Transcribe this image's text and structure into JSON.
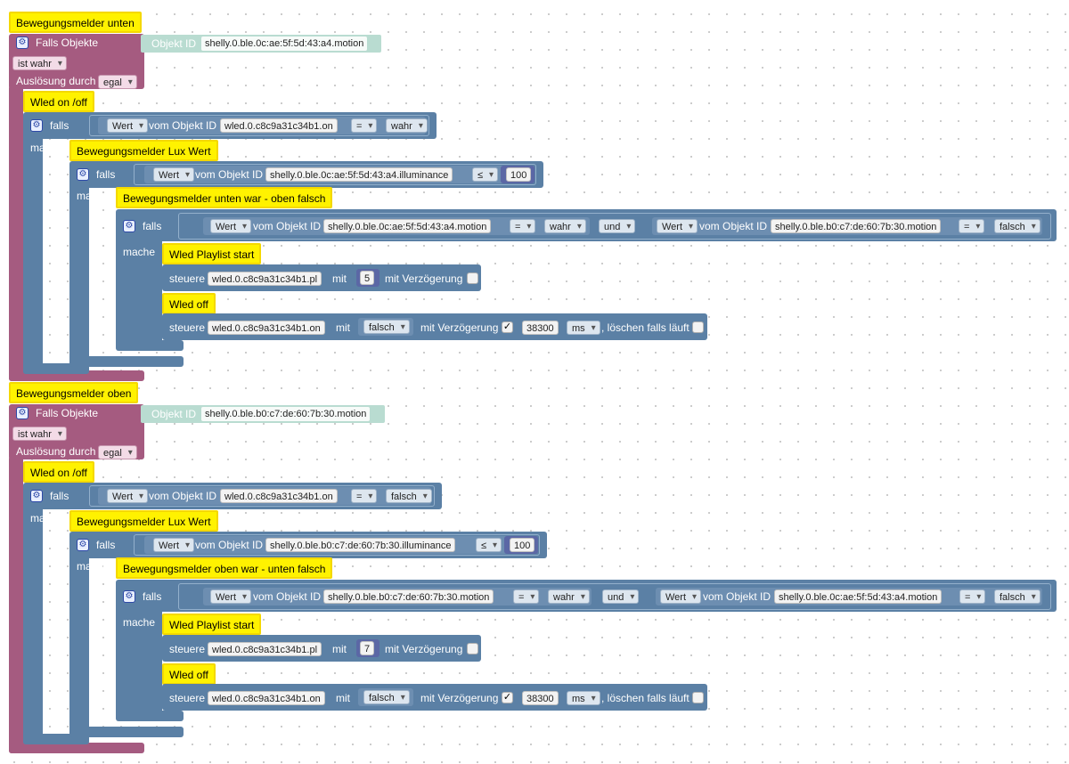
{
  "labels": {
    "falls_objekte": "Falls Objekte",
    "objekt_id": "Objekt ID",
    "ausloesung_durch": "Auslösung durch",
    "falls": "falls",
    "mache": "mache",
    "vom_objekt_id": "vom Objekt ID",
    "und": "und",
    "steuere": "steuere",
    "mit": "mit",
    "mit_verzoegerung": "mit Verzögerung",
    "loeschen_falls_laeuft": ", löschen falls läuft"
  },
  "icons": {
    "gear": "gear-icon",
    "checkmark": "checkmark-icon"
  },
  "colors": {
    "trigger": "#a55b80",
    "logic": "#5b80a5",
    "comment": "#fff200",
    "number": "#5b67a5"
  },
  "triggers": [
    {
      "comment": "Bewegungsmelder unten",
      "object_id": "shelly.0.ble.0c:ae:5f:5d:43:a4.motion",
      "condition": "ist wahr",
      "trigger_by": "egal",
      "if1": {
        "comment": "Wled on /off",
        "value": "Wert",
        "object": "wled.0.c8c9a31c34b1.on",
        "op": "=",
        "compare": "wahr"
      },
      "if2": {
        "comment": "Bewegungsmelder Lux Wert",
        "value": "Wert",
        "object": "shelly.0.ble.0c:ae:5f:5d:43:a4.illuminance",
        "op": "≤",
        "compare": "100"
      },
      "if3": {
        "comment": "Bewegungsmelder unten war - oben falsch",
        "a_value": "Wert",
        "a_object": "shelly.0.ble.0c:ae:5f:5d:43:a4.motion",
        "a_op": "=",
        "a_compare": "wahr",
        "logic": "und",
        "b_value": "Wert",
        "b_object": "shelly.0.ble.b0:c7:de:60:7b:30.motion",
        "b_op": "=",
        "b_compare": "falsch"
      },
      "ctrl1": {
        "comment": "Wled Playlist start",
        "object": "wled.0.c8c9a31c34b1.pl",
        "value": "5"
      },
      "ctrl2": {
        "comment": "Wled off",
        "object": "wled.0.c8c9a31c34b1.on",
        "value": "falsch",
        "delay": "38300",
        "unit": "ms",
        "check": "✓"
      }
    },
    {
      "comment": "Bewegungsmelder oben",
      "object_id": "shelly.0.ble.b0:c7:de:60:7b:30.motion",
      "condition": "ist wahr",
      "trigger_by": "egal",
      "if1": {
        "comment": "Wled on /off",
        "value": "Wert",
        "object": "wled.0.c8c9a31c34b1.on",
        "op": "=",
        "compare": "falsch"
      },
      "if2": {
        "comment": "Bewegungsmelder Lux Wert",
        "value": "Wert",
        "object": "shelly.0.ble.b0:c7:de:60:7b:30.illuminance",
        "op": "≤",
        "compare": "100"
      },
      "if3": {
        "comment": "Bewegungsmelder oben war - unten falsch",
        "a_value": "Wert",
        "a_object": "shelly.0.ble.b0:c7:de:60:7b:30.motion",
        "a_op": "=",
        "a_compare": "wahr",
        "logic": "und",
        "b_value": "Wert",
        "b_object": "shelly.0.ble.0c:ae:5f:5d:43:a4.motion",
        "b_op": "=",
        "b_compare": "falsch"
      },
      "ctrl1": {
        "comment": "Wled Playlist start",
        "object": "wled.0.c8c9a31c34b1.pl",
        "value": "7"
      },
      "ctrl2": {
        "comment": "Wled off",
        "object": "wled.0.c8c9a31c34b1.on",
        "value": "falsch",
        "delay": "38300",
        "unit": "ms",
        "check": "✓"
      }
    }
  ]
}
